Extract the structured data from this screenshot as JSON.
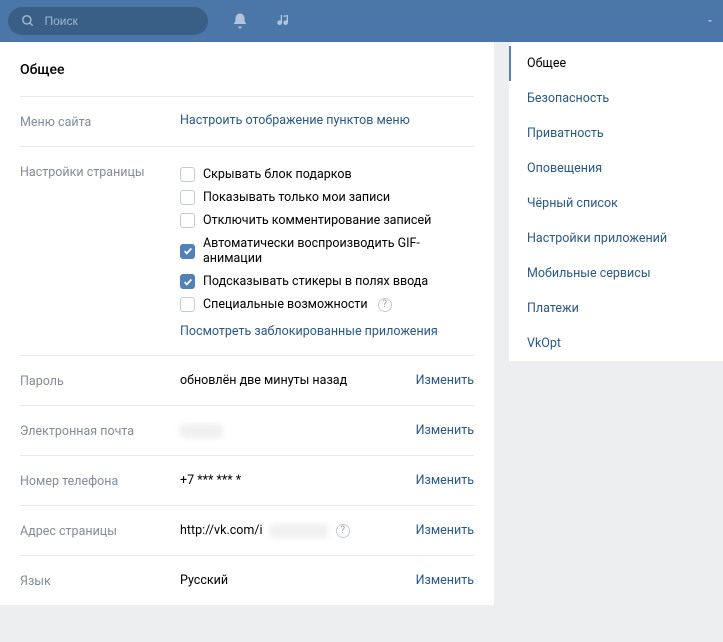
{
  "header": {
    "search_placeholder": "Поиск"
  },
  "page": {
    "title": "Общее"
  },
  "menu": {
    "label": "Меню сайта",
    "configure": "Настроить отображение пунктов меню"
  },
  "page_settings": {
    "label": "Настройки страницы",
    "options": [
      {
        "label": "Скрывать блок подарков",
        "checked": false
      },
      {
        "label": "Показывать только мои записи",
        "checked": false
      },
      {
        "label": "Отключить комментирование записей",
        "checked": false
      },
      {
        "label": "Автоматически воспроизводить GIF-анимации",
        "checked": true
      },
      {
        "label": "Подсказывать стикеры в полях ввода",
        "checked": true
      },
      {
        "label": "Специальные возможности",
        "checked": false,
        "help": true
      }
    ],
    "blocked_link": "Посмотреть заблокированные приложения"
  },
  "password": {
    "label": "Пароль",
    "value": "обновлён две минуты назад",
    "action": "Изменить"
  },
  "email": {
    "label": "Электронная почта",
    "value": "",
    "action": "Изменить"
  },
  "phone": {
    "label": "Номер телефона",
    "value": "+7 *** *** *",
    "action": "Изменить"
  },
  "address": {
    "label": "Адрес страницы",
    "value": "http://vk.com/i",
    "action": "Изменить"
  },
  "language": {
    "label": "Язык",
    "value": "Русский",
    "action": "Изменить"
  },
  "sidebar": {
    "items": [
      "Общее",
      "Безопасность",
      "Приватность",
      "Оповещения",
      "Чёрный список",
      "Настройки приложений",
      "Мобильные сервисы",
      "Платежи",
      "VkOpt"
    ],
    "active_index": 0
  }
}
